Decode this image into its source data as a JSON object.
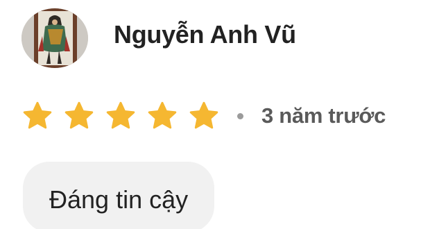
{
  "review": {
    "reviewer": {
      "name": "Nguyễn Anh Vũ",
      "avatar_icon": "avatar-painting-icon"
    },
    "rating": {
      "stars": 5,
      "max": 5,
      "star_color": "#F5B731",
      "star_icon": "star-icon"
    },
    "separator_icon": "dot-icon",
    "time_ago": "3 năm trước",
    "tags": [
      {
        "label": "Đáng tin cậy"
      }
    ]
  },
  "colors": {
    "background": "#ffffff",
    "text_primary": "#222222",
    "text_secondary": "#5a5a5a",
    "chip_background": "#f1f1f1",
    "separator": "#9b9b9b"
  }
}
